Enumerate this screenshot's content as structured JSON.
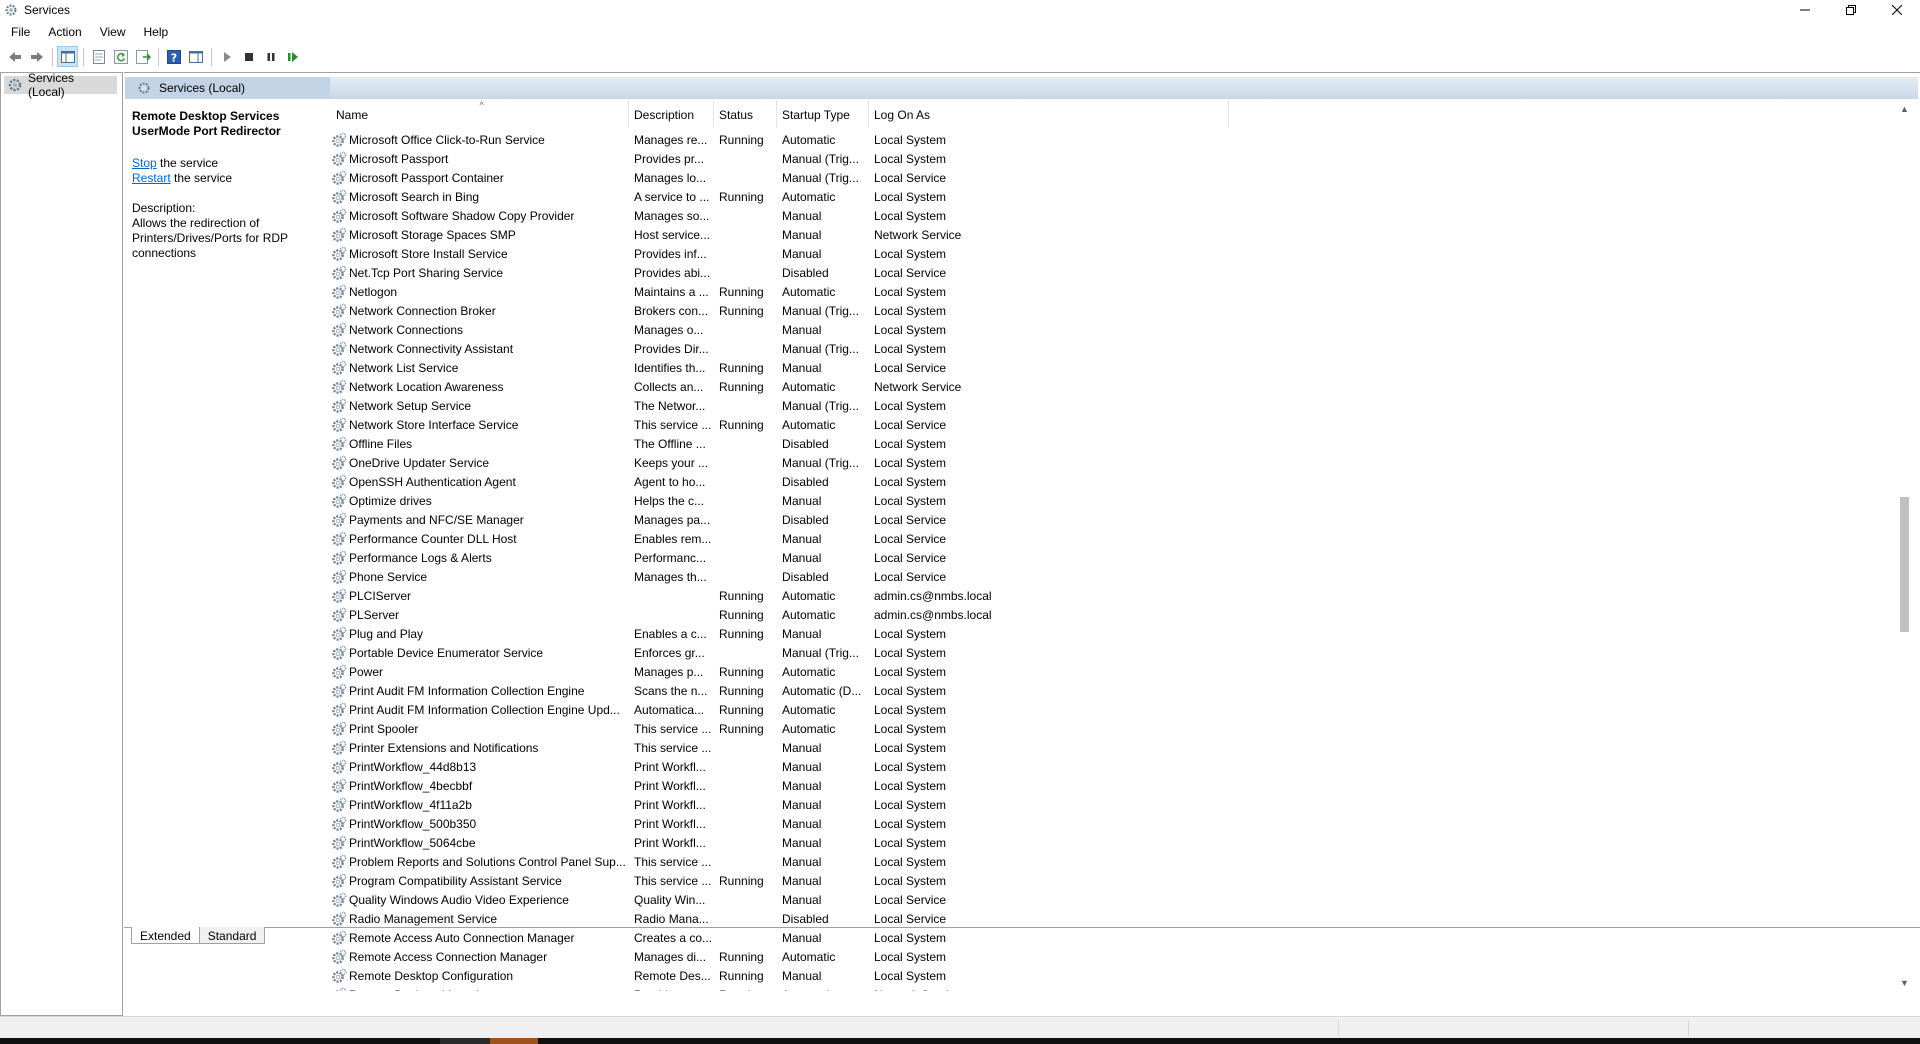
{
  "window": {
    "title": "Services"
  },
  "menu": [
    "File",
    "Action",
    "View",
    "Help"
  ],
  "tree": {
    "root_label": "Services (Local)"
  },
  "pane_header": {
    "title": "Services (Local)"
  },
  "details": {
    "service_name": "Remote Desktop Services UserMode Port Redirector",
    "stop_link": "Stop",
    "stop_suffix": " the service",
    "restart_link": "Restart",
    "restart_suffix": " the service",
    "description_label": "Description:",
    "description_text": "Allows the redirection of Printers/Drives/Ports for RDP connections"
  },
  "columns": {
    "name": "Name",
    "description": "Description",
    "status": "Status",
    "startup": "Startup Type",
    "logon": "Log On As"
  },
  "services": [
    [
      "Microsoft Office Click-to-Run Service",
      "Manages re...",
      "Running",
      "Automatic",
      "Local System"
    ],
    [
      "Microsoft Passport",
      "Provides pr...",
      "",
      "Manual (Trig...",
      "Local System"
    ],
    [
      "Microsoft Passport Container",
      "Manages lo...",
      "",
      "Manual (Trig...",
      "Local Service"
    ],
    [
      "Microsoft Search in Bing",
      "A service to ...",
      "Running",
      "Automatic",
      "Local System"
    ],
    [
      "Microsoft Software Shadow Copy Provider",
      "Manages so...",
      "",
      "Manual",
      "Local System"
    ],
    [
      "Microsoft Storage Spaces SMP",
      "Host service...",
      "",
      "Manual",
      "Network Service"
    ],
    [
      "Microsoft Store Install Service",
      "Provides inf...",
      "",
      "Manual",
      "Local System"
    ],
    [
      "Net.Tcp Port Sharing Service",
      "Provides abi...",
      "",
      "Disabled",
      "Local Service"
    ],
    [
      "Netlogon",
      "Maintains a ...",
      "Running",
      "Automatic",
      "Local System"
    ],
    [
      "Network Connection Broker",
      "Brokers con...",
      "Running",
      "Manual (Trig...",
      "Local System"
    ],
    [
      "Network Connections",
      "Manages o...",
      "",
      "Manual",
      "Local System"
    ],
    [
      "Network Connectivity Assistant",
      "Provides Dir...",
      "",
      "Manual (Trig...",
      "Local System"
    ],
    [
      "Network List Service",
      "Identifies th...",
      "Running",
      "Manual",
      "Local Service"
    ],
    [
      "Network Location Awareness",
      "Collects an...",
      "Running",
      "Automatic",
      "Network Service"
    ],
    [
      "Network Setup Service",
      "The Networ...",
      "",
      "Manual (Trig...",
      "Local System"
    ],
    [
      "Network Store Interface Service",
      "This service ...",
      "Running",
      "Automatic",
      "Local Service"
    ],
    [
      "Offline Files",
      "The Offline ...",
      "",
      "Disabled",
      "Local System"
    ],
    [
      "OneDrive Updater Service",
      "Keeps your ...",
      "",
      "Manual (Trig...",
      "Local System"
    ],
    [
      "OpenSSH Authentication Agent",
      "Agent to ho...",
      "",
      "Disabled",
      "Local System"
    ],
    [
      "Optimize drives",
      "Helps the c...",
      "",
      "Manual",
      "Local System"
    ],
    [
      "Payments and NFC/SE Manager",
      "Manages pa...",
      "",
      "Disabled",
      "Local Service"
    ],
    [
      "Performance Counter DLL Host",
      "Enables rem...",
      "",
      "Manual",
      "Local Service"
    ],
    [
      "Performance Logs & Alerts",
      "Performanc...",
      "",
      "Manual",
      "Local Service"
    ],
    [
      "Phone Service",
      "Manages th...",
      "",
      "Disabled",
      "Local Service"
    ],
    [
      "PLCIServer",
      "",
      "Running",
      "Automatic",
      "admin.cs@nmbs.local"
    ],
    [
      "PLServer",
      "",
      "Running",
      "Automatic",
      "admin.cs@nmbs.local"
    ],
    [
      "Plug and Play",
      "Enables a c...",
      "Running",
      "Manual",
      "Local System"
    ],
    [
      "Portable Device Enumerator Service",
      "Enforces gr...",
      "",
      "Manual (Trig...",
      "Local System"
    ],
    [
      "Power",
      "Manages p...",
      "Running",
      "Automatic",
      "Local System"
    ],
    [
      "Print Audit FM Information Collection Engine",
      "Scans the n...",
      "Running",
      "Automatic (D...",
      "Local System"
    ],
    [
      "Print Audit FM Information Collection Engine Upd...",
      "Automatica...",
      "Running",
      "Automatic",
      "Local System"
    ],
    [
      "Print Spooler",
      "This service ...",
      "Running",
      "Automatic",
      "Local System"
    ],
    [
      "Printer Extensions and Notifications",
      "This service ...",
      "",
      "Manual",
      "Local System"
    ],
    [
      "PrintWorkflow_44d8b13",
      "Print Workfl...",
      "",
      "Manual",
      "Local System"
    ],
    [
      "PrintWorkflow_4becbbf",
      "Print Workfl...",
      "",
      "Manual",
      "Local System"
    ],
    [
      "PrintWorkflow_4f11a2b",
      "Print Workfl...",
      "",
      "Manual",
      "Local System"
    ],
    [
      "PrintWorkflow_500b350",
      "Print Workfl...",
      "",
      "Manual",
      "Local System"
    ],
    [
      "PrintWorkflow_5064cbe",
      "Print Workfl...",
      "",
      "Manual",
      "Local System"
    ],
    [
      "Problem Reports and Solutions Control Panel Sup...",
      "This service ...",
      "",
      "Manual",
      "Local System"
    ],
    [
      "Program Compatibility Assistant Service",
      "This service ...",
      "Running",
      "Manual",
      "Local System"
    ],
    [
      "Quality Windows Audio Video Experience",
      "Quality Win...",
      "",
      "Manual",
      "Local Service"
    ],
    [
      "Radio Management Service",
      "Radio Mana...",
      "",
      "Disabled",
      "Local Service"
    ],
    [
      "Remote Access Auto Connection Manager",
      "Creates a co...",
      "",
      "Manual",
      "Local System"
    ],
    [
      "Remote Access Connection Manager",
      "Manages di...",
      "Running",
      "Automatic",
      "Local System"
    ],
    [
      "Remote Desktop Configuration",
      "Remote Des...",
      "Running",
      "Manual",
      "Local System"
    ],
    [
      "Remote Desktop Licensing",
      "Provides re...",
      "Running",
      "Automatic",
      "Network Service"
    ]
  ],
  "tabs": [
    "Extended",
    "Standard"
  ],
  "icons": {
    "app": "services-gear-icon",
    "toolbar": [
      "back-icon",
      "forward-icon",
      "show-hide-console-tree-icon",
      "properties-icon",
      "refresh-icon",
      "export-list-icon",
      "help-icon",
      "show-hide-action-pane-icon",
      "start-service-icon",
      "stop-service-icon",
      "pause-service-icon",
      "restart-service-icon"
    ]
  }
}
